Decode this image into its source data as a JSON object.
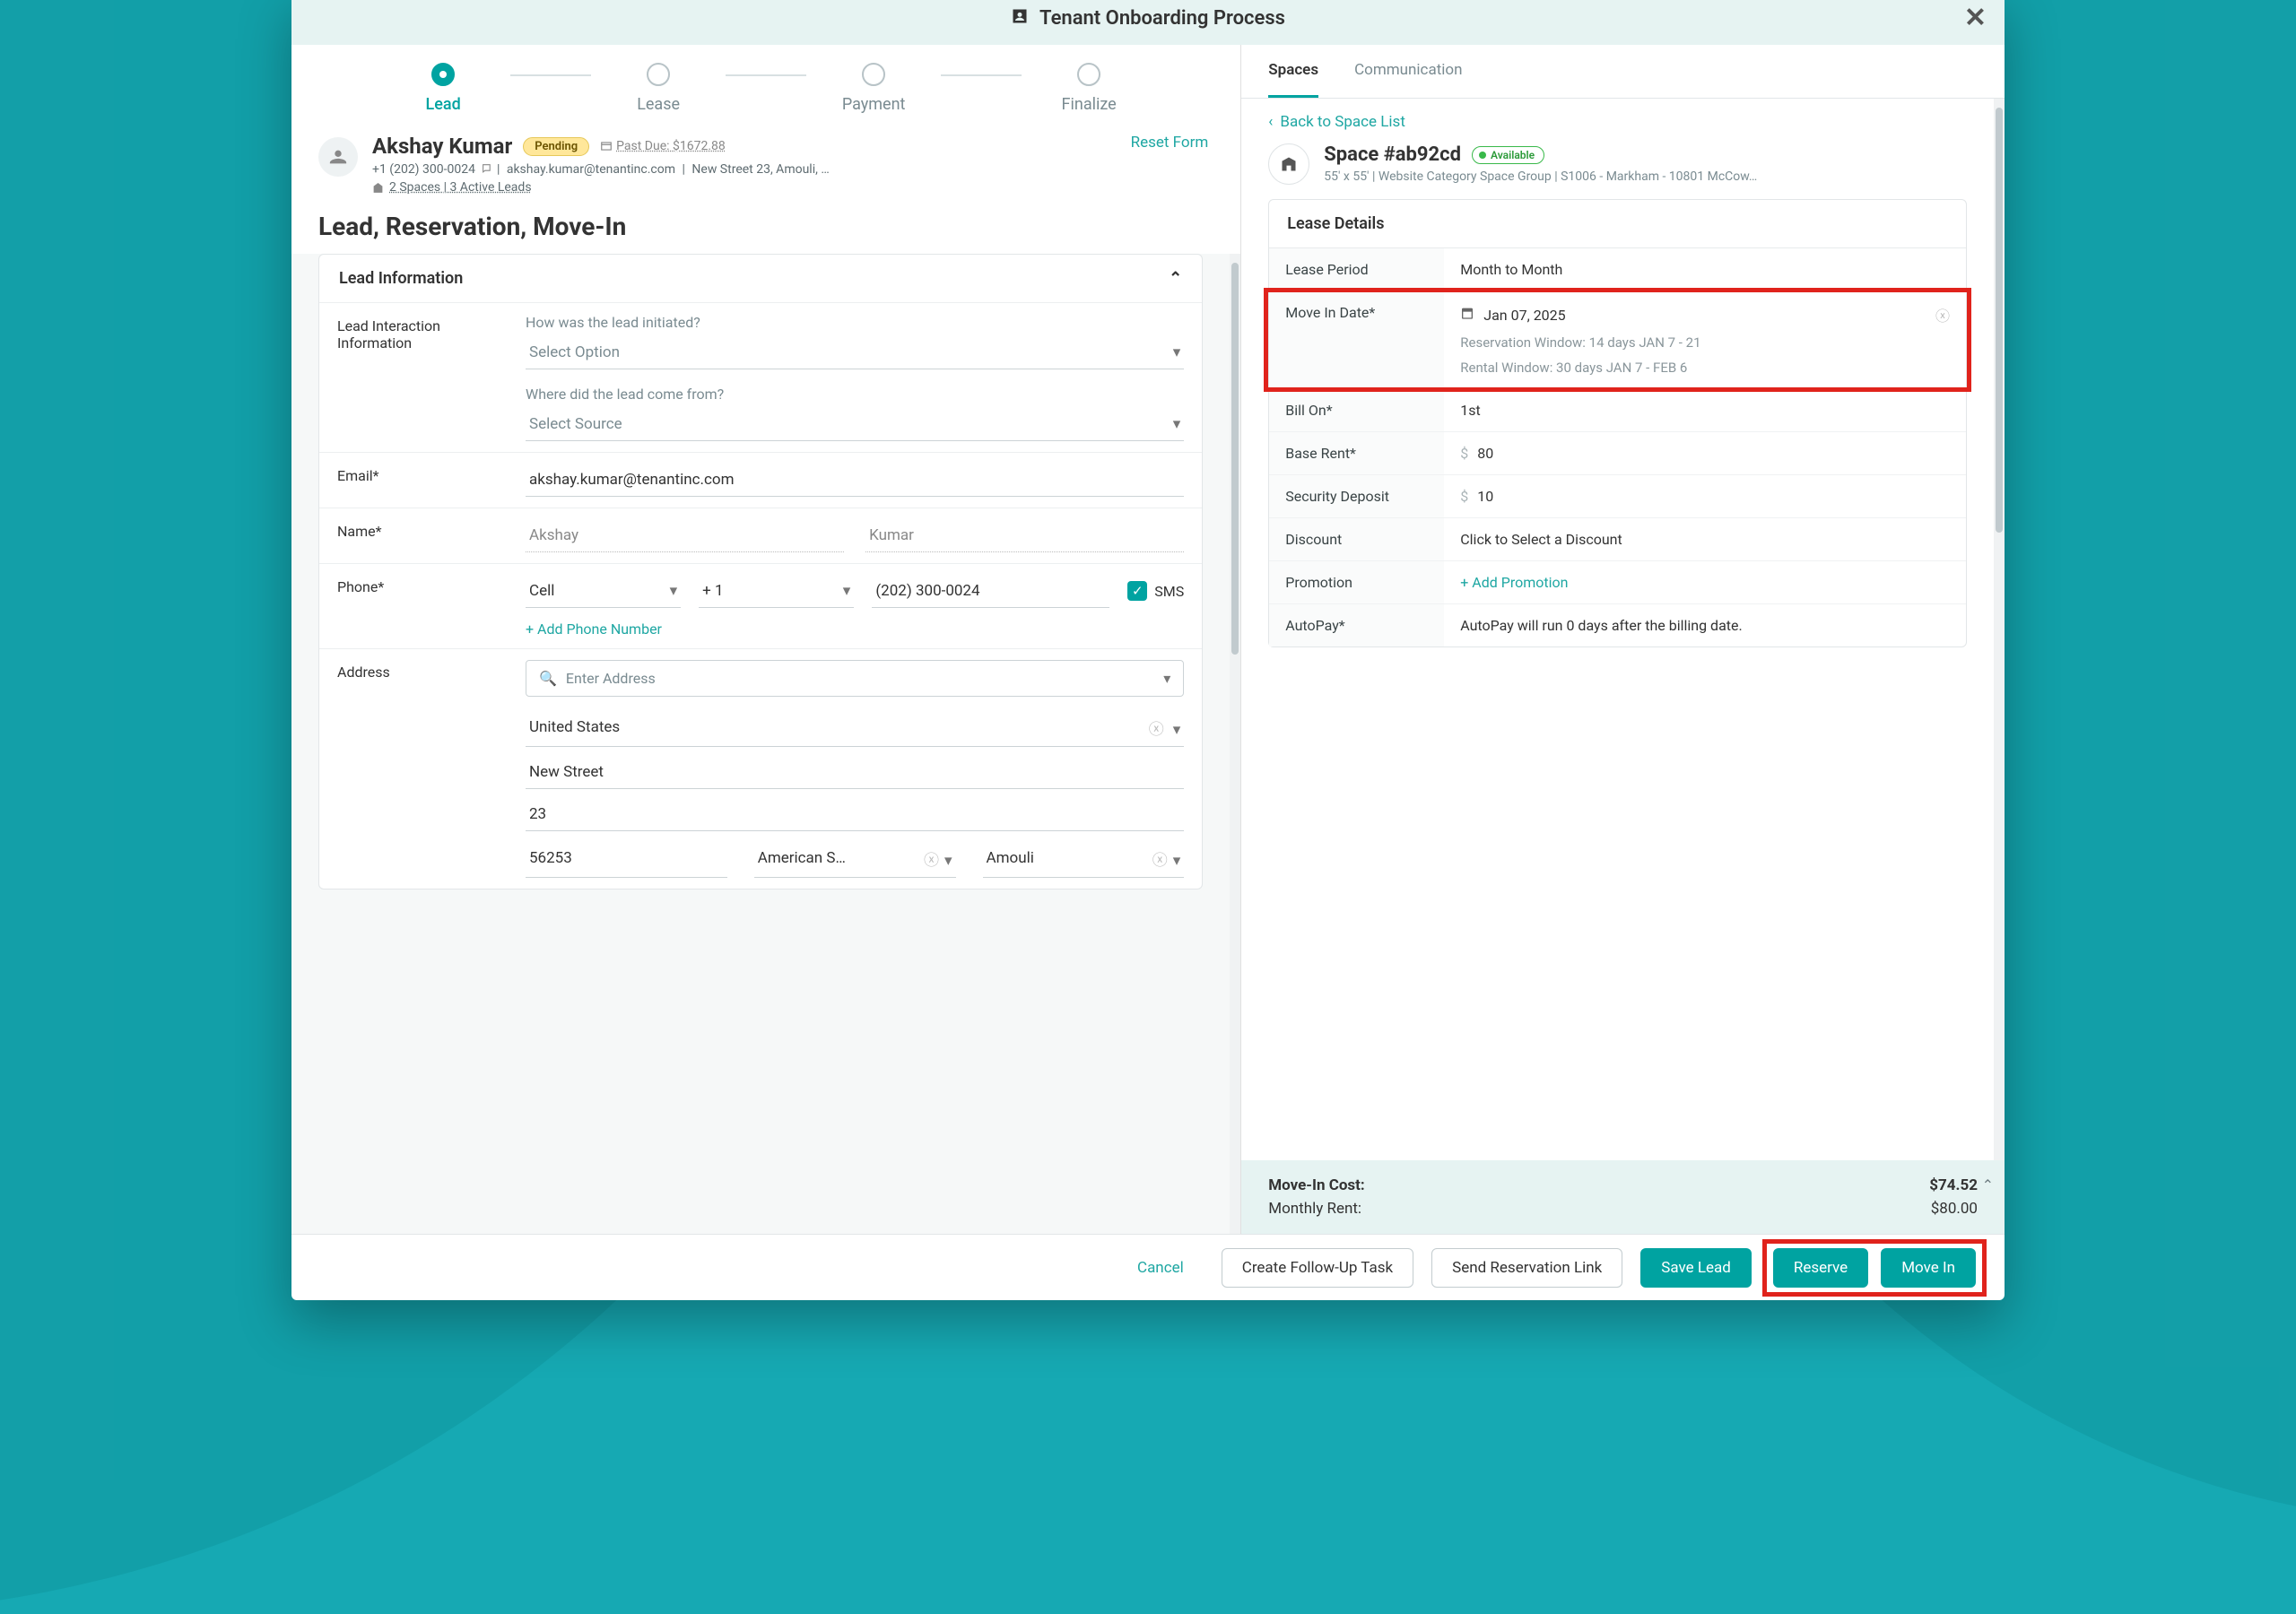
{
  "modal_title": "Tenant Onboarding Process",
  "steps": [
    "Lead",
    "Lease",
    "Payment",
    "Finalize"
  ],
  "lead": {
    "name": "Akshay Kumar",
    "status_badge": "Pending",
    "past_due_label": "Past Due: $1672.88",
    "phone": "+1 (202) 300-0024",
    "email": "akshay.kumar@tenantinc.com",
    "address_line": "New Street 23, Amouli, …",
    "spaces_leads": "2 Spaces  |  3 Active Leads",
    "reset_link": "Reset Form"
  },
  "section_title": "Lead, Reservation, Move-In",
  "panel_title": "Lead Information",
  "rows": {
    "lead_interaction_label": "Lead Interaction Information",
    "q1": "How was the lead initiated?",
    "q1_placeholder": "Select Option",
    "q2": "Where did the lead come from?",
    "q2_placeholder": "Select Source",
    "email_label": "Email*",
    "email_value": "akshay.kumar@tenantinc.com",
    "name_label": "Name*",
    "first_name": "Akshay",
    "last_name": "Kumar",
    "phone_label": "Phone*",
    "phone_type": "Cell",
    "phone_cc": "+ 1",
    "phone_num": "(202) 300-0024",
    "sms_label": "SMS",
    "add_phone": "+ Add Phone Number",
    "address_label": "Address",
    "address_placeholder": "Enter Address",
    "country": "United States",
    "street": "New Street",
    "street_no": "23",
    "zip": "56253",
    "state": "American S…",
    "city": "Amouli"
  },
  "right": {
    "tab_spaces": "Spaces",
    "tab_comm": "Communication",
    "back": "Back to Space List",
    "space_title": "Space #ab92cd",
    "availability": "Available",
    "space_sub": "55' x 55'  |  Website Category Space Group  |  S1006 - Markham - 10801 McCow…",
    "lease_details_title": "Lease Details",
    "lease_period_label": "Lease Period",
    "lease_period": "Month to Month",
    "movein_label": "Move In Date*",
    "movein_date": "Jan 07, 2025",
    "res_window": "Reservation Window: 14 days JAN 7 - 21",
    "rental_window": "Rental Window: 30 days JAN 7 - FEB 6",
    "billon_label": "Bill On*",
    "billon": "1st",
    "baserent_label": "Base Rent*",
    "baserent": "80",
    "secdep_label": "Security Deposit",
    "secdep": "10",
    "discount_label": "Discount",
    "discount": "Click to Select a Discount",
    "promo_label": "Promotion",
    "promo": "+ Add Promotion",
    "autopay_label": "AutoPay*",
    "autopay": "AutoPay will run 0 days after the billing date."
  },
  "cost": {
    "movein_label": "Move-In Cost:",
    "movein": "$74.52",
    "rent_label": "Monthly Rent:",
    "rent": "$80.00"
  },
  "footer": {
    "cancel": "Cancel",
    "followup": "Create Follow-Up Task",
    "sendres": "Send Reservation Link",
    "savelead": "Save Lead",
    "reserve": "Reserve",
    "movein": "Move In"
  }
}
